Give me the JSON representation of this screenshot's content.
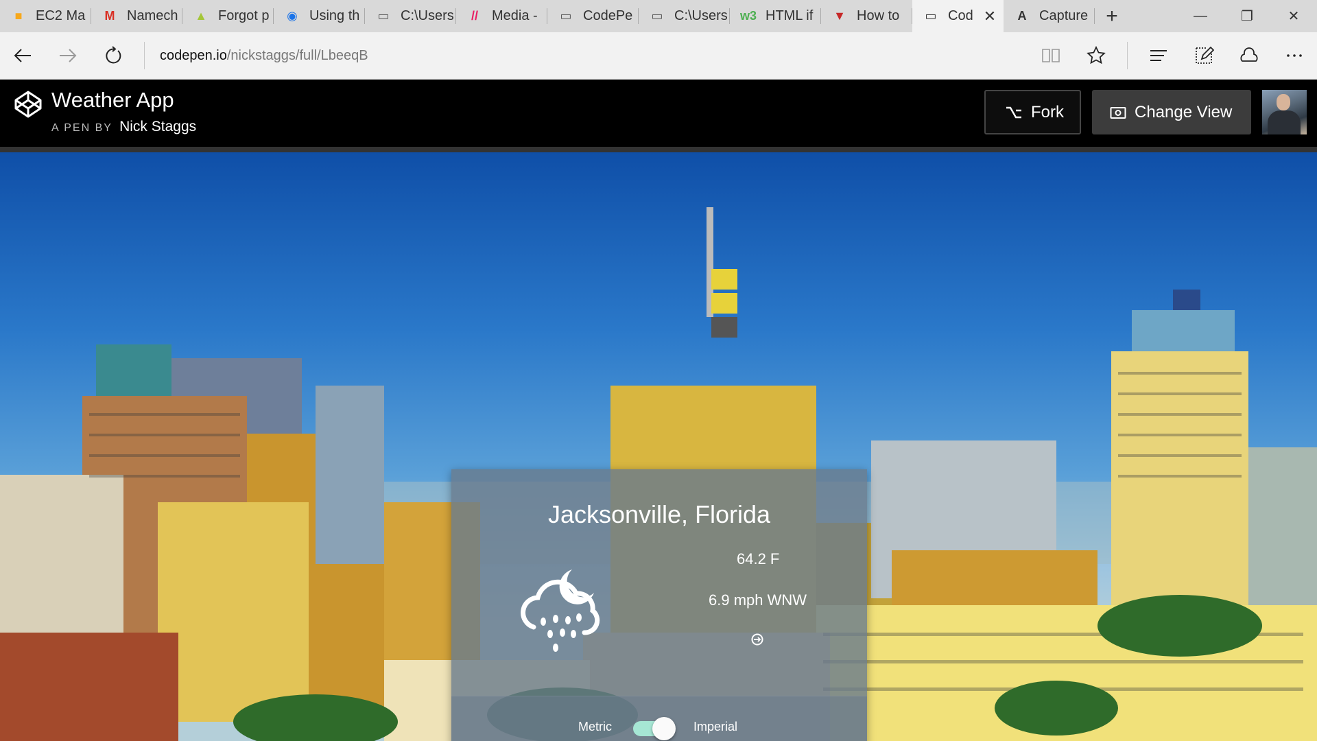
{
  "browser": {
    "tabs": [
      {
        "label": "EC2 Ma",
        "icon": "aws-icon",
        "color": "#f7a81b"
      },
      {
        "label": "Namech",
        "icon": "gmail-icon",
        "color": "#d93025"
      },
      {
        "label": "Forgot p",
        "icon": "android-icon",
        "color": "#a4c639"
      },
      {
        "label": "Using th",
        "icon": "blue-app-icon",
        "color": "#1a73e8"
      },
      {
        "label": "C:\\Users",
        "icon": "page-icon",
        "color": "#555555"
      },
      {
        "label": "Media -",
        "icon": "media-icon",
        "color": "#e91e63"
      },
      {
        "label": "CodePe",
        "icon": "page-icon",
        "color": "#555555"
      },
      {
        "label": "C:\\Users",
        "icon": "page-icon",
        "color": "#555555"
      },
      {
        "label": "HTML if",
        "icon": "w3-icon",
        "color": "#4caf50"
      },
      {
        "label": "How to",
        "icon": "red-logo-icon",
        "color": "#c62828"
      },
      {
        "label": "Cod",
        "icon": "page-icon",
        "color": "#333333",
        "active": true
      },
      {
        "label": "Capture",
        "icon": "letter-a-icon",
        "color": "#333333"
      }
    ],
    "url_host": "codepen.io",
    "url_path": "/nickstaggs/full/LbeeqB"
  },
  "codepen": {
    "title": "Weather App",
    "by_prefix": "A PEN BY",
    "author": "Nick Staggs",
    "fork_label": "Fork",
    "change_view_label": "Change View"
  },
  "weather": {
    "location": "Jacksonville, Florida",
    "temperature": "64.2 F",
    "wind": "6.9 mph WNW",
    "unit_left": "Metric",
    "unit_right": "Imperial",
    "imperial_selected": true,
    "condition_icon": "night-rain-icon",
    "toggle_color": "#a6e6d4"
  }
}
